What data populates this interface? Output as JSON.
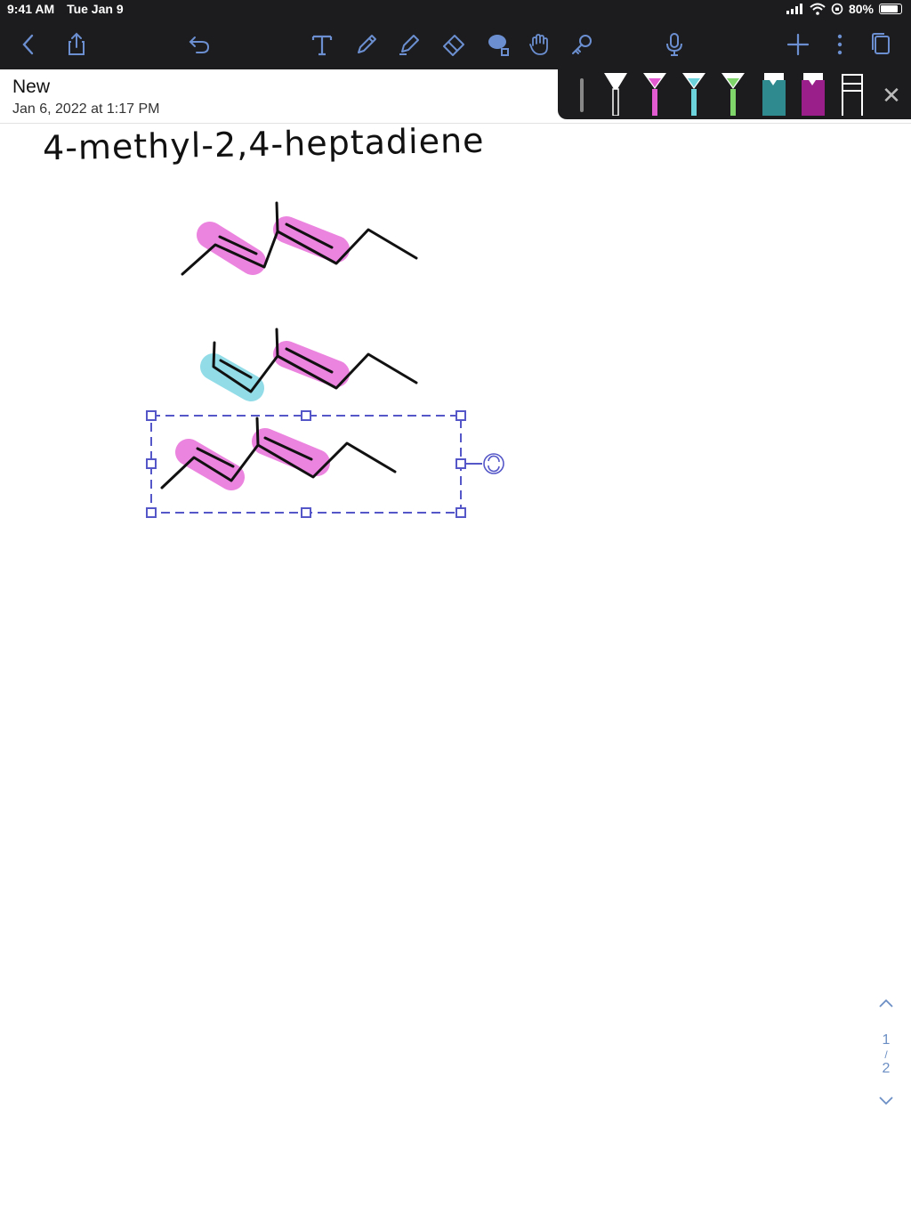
{
  "status_bar": {
    "time": "9:41 AM",
    "date": "Tue Jan 9",
    "battery": "80%"
  },
  "toolbar": {
    "left_icons": [
      "back-icon",
      "share-icon",
      "undo-icon"
    ],
    "tools": [
      "text-tool-icon",
      "pencil-icon",
      "highlighter-icon",
      "eraser-icon",
      "lasso-icon",
      "hand-icon",
      "key-icon"
    ],
    "right_icons": [
      "microphone-icon",
      "plus-icon",
      "more-icon",
      "pages-icon"
    ]
  },
  "document": {
    "title": "New",
    "date": "Jan 6, 2022 at 1:17 PM"
  },
  "highlighter_palette": {
    "colors": [
      "#ffffff",
      "#e25bd1",
      "#6cd2dc",
      "#7fd46a",
      "#2e8a8f",
      "#9b1f8b"
    ]
  },
  "canvas": {
    "handwritten_title": "4-methyl-2,4-heptadiene",
    "highlight_colors": {
      "pink": "#e76fd8",
      "cyan": "#7fd6e3"
    },
    "selection_color": "#5557c8"
  },
  "pager": {
    "current": "1",
    "separator": "/",
    "total": "2"
  }
}
